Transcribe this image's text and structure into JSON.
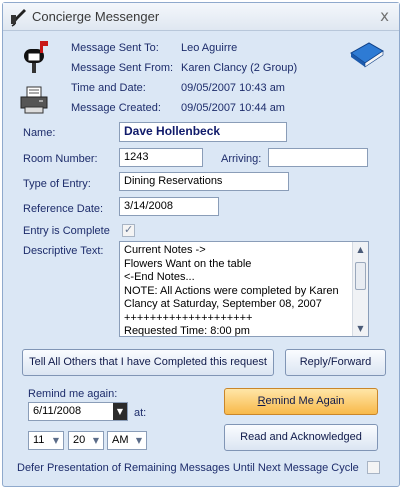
{
  "window": {
    "title": "Concierge Messenger",
    "close_glyph": "x"
  },
  "header": {
    "sent_to_label": "Message Sent To:",
    "sent_to_value": "Leo Aguirre",
    "sent_from_label": "Message Sent From:",
    "sent_from_value": "Karen Clancy  (2 Group)",
    "time_date_label": "Time and Date:",
    "time_date_value": "09/05/2007 10:43 am",
    "created_label": "Message Created:",
    "created_value": "09/05/2007 10:44 am"
  },
  "form": {
    "name_label": "Name:",
    "name_value": "Dave Hollenbeck",
    "room_label": "Room Number:",
    "room_value": "1243",
    "arriving_label": "Arriving:",
    "arriving_value": "",
    "entry_type_label": "Type of Entry:",
    "entry_type_value": "Dining Reservations",
    "ref_date_label": "Reference Date:",
    "ref_date_value": "3/14/2008",
    "complete_label": "Entry is Complete",
    "complete_checked": true,
    "desc_label": "Descriptive Text:",
    "desc_lines": [
      "Current Notes ->",
      "Flowers Want on the table",
      "<-End Notes...",
      "NOTE:  All Actions were completed by Karen",
      "Clancy at Saturday, September 08, 2007",
      "++++++++++++++++++++",
      "Requested Time: 8:00 pm"
    ]
  },
  "buttons": {
    "tell_others": "Tell All Others that I have Completed this request",
    "reply_forward": "Reply/Forward",
    "remind_again_underlined": "R",
    "remind_again_rest": "emind Me Again",
    "read_ack": "Read and Acknowledged"
  },
  "remind": {
    "label": "Remind me again:",
    "date_value": "6/11/2008",
    "at_label": "at:",
    "hour": "11",
    "minute": "20",
    "ampm": "AM"
  },
  "footer": {
    "defer_label": "Defer Presentation of Remaining Messages Until Next Message Cycle",
    "defer_checked": false
  },
  "icons": {
    "title": "quill-icon",
    "mailbox": "mailbox-icon",
    "printer": "printer-icon",
    "book": "book-icon",
    "check": "✓"
  }
}
